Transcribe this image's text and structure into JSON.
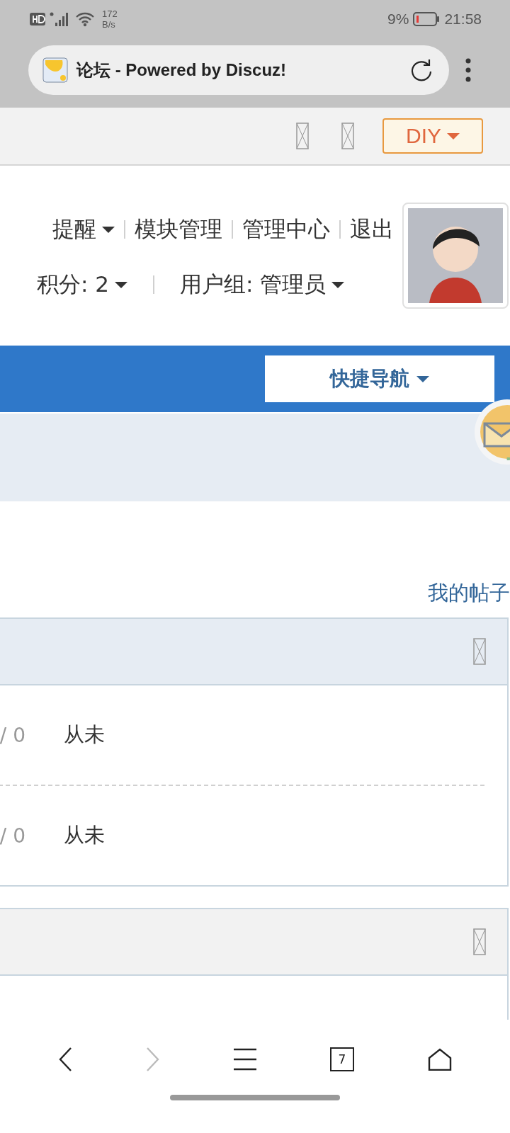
{
  "status_bar": {
    "network_speed": "172",
    "speed_unit": "B/s",
    "battery_percent": "9%",
    "time": "21:58"
  },
  "browser": {
    "page_title": "论坛 - Powered by Discuz!"
  },
  "toolbar": {
    "diy_button": "DIY"
  },
  "user_links": [
    {
      "label": "提醒",
      "dropdown": true
    },
    {
      "label": "模块管理",
      "dropdown": false
    },
    {
      "label": "管理中心",
      "dropdown": false
    },
    {
      "label": "退出",
      "dropdown": false
    }
  ],
  "user_stats": [
    {
      "label": "积分: 2",
      "dropdown": true
    },
    {
      "label": "用户组: 管理员",
      "dropdown": true
    }
  ],
  "nav": {
    "quick_nav": "快捷导航"
  },
  "my_posts_link": "我的帖子",
  "cards": [
    {
      "highlighted": true,
      "rows": [
        {
          "column_1": "/ 0",
          "column_2": "从未"
        },
        {
          "column_1": "/ 0",
          "column_2": "从未"
        }
      ]
    },
    {
      "highlighted": false
    }
  ],
  "bottom_nav": {
    "forward_disabled": true,
    "tab_count": "7"
  }
}
